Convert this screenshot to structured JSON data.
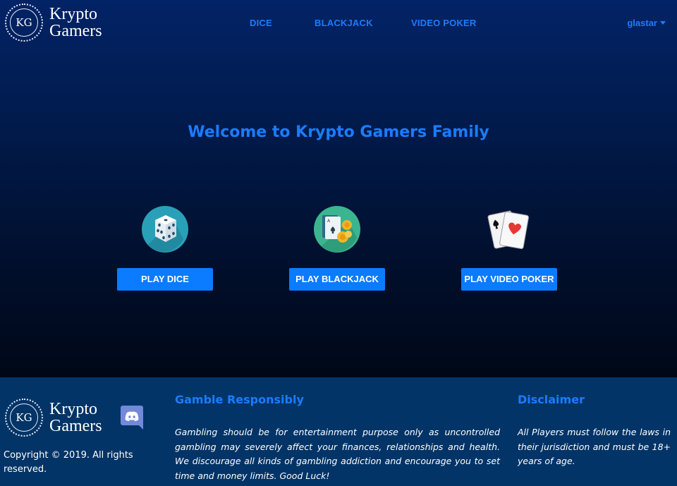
{
  "brand": {
    "initials": "KG",
    "name_line1": "Krypto",
    "name_line2": "Gamers"
  },
  "nav": {
    "items": [
      {
        "label": "DICE"
      },
      {
        "label": "BLACKJACK"
      },
      {
        "label": "VIDEO POKER"
      }
    ],
    "user": "glastar"
  },
  "hero": {
    "title": "Welcome to Krypto Gamers Family"
  },
  "games": [
    {
      "button": "PLAY DICE",
      "icon": "dice-icon"
    },
    {
      "button": "PLAY BLACKJACK",
      "icon": "cards-chips-icon"
    },
    {
      "button": "PLAY VIDEO POKER",
      "icon": "playing-cards-icon"
    }
  ],
  "footer": {
    "copyright": "Copyright © 2019. All rights reserved.",
    "discord_icon": "discord-icon",
    "responsible": {
      "heading": "Gamble Responsibly",
      "text": "Gambling should be for entertainment purpose only as uncontrolled gambling may severely affect your finances, relationships and health. We discourage all kinds of gambling addiction and encourage you to set time and money limits. Good Luck!"
    },
    "disclaimer": {
      "heading": "Disclaimer",
      "text": "All Players must follow the laws in their jurisdiction and must be 18+ years of age."
    }
  },
  "colors": {
    "accent": "#1a7cff",
    "button": "#0b7bff",
    "footer_bg": "#033467",
    "hero_top": "#022366",
    "hero_bottom": "#000817"
  }
}
